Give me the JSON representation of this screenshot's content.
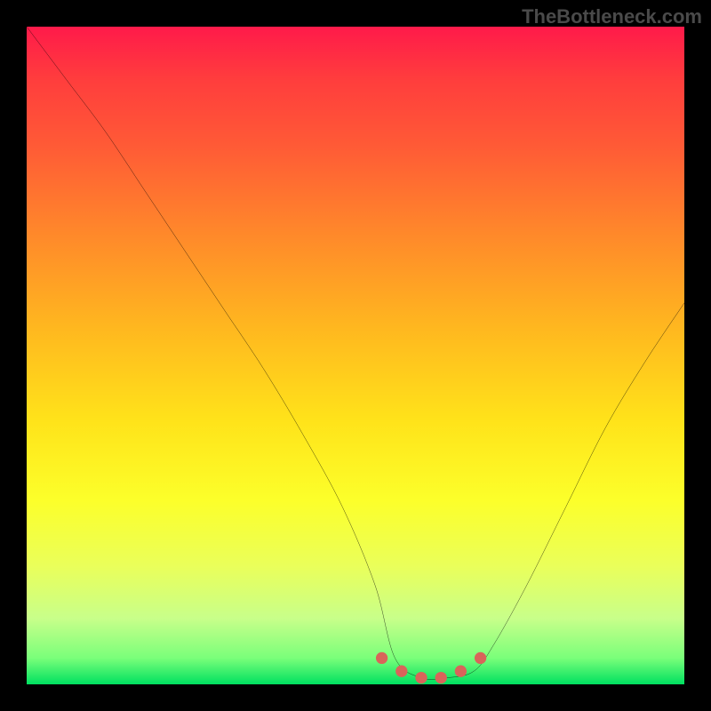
{
  "watermark": "TheBottleneck.com",
  "chart_data": {
    "type": "line",
    "title": "",
    "xlabel": "",
    "ylabel": "",
    "xlim": [
      0,
      100
    ],
    "ylim": [
      0,
      100
    ],
    "grid": false,
    "legend": false,
    "description": "Bottleneck curve on red-to-green heat gradient. Y axis = mismatch percentage (100 at top, 0 at bottom). Curve descends from top-left to a flat minimum near x≈56-68, then rises toward upper right. Flat minimum region is marked with salmon dots.",
    "series": [
      {
        "name": "bottleneck-curve",
        "color": "#000000",
        "x": [
          0,
          6,
          12,
          18,
          24,
          30,
          36,
          42,
          48,
          53,
          56,
          60,
          64,
          68,
          71,
          76,
          82,
          88,
          94,
          100
        ],
        "values": [
          100,
          92,
          84,
          75,
          66,
          57,
          48,
          38,
          27,
          15,
          4,
          1,
          1,
          2,
          6,
          15,
          27,
          39,
          49,
          58
        ]
      }
    ],
    "markers": {
      "name": "optimal-range-dots",
      "color": "#d9645a",
      "x": [
        54,
        57,
        60,
        63,
        66,
        69
      ],
      "values": [
        4,
        2,
        1,
        1,
        2,
        4
      ]
    }
  }
}
